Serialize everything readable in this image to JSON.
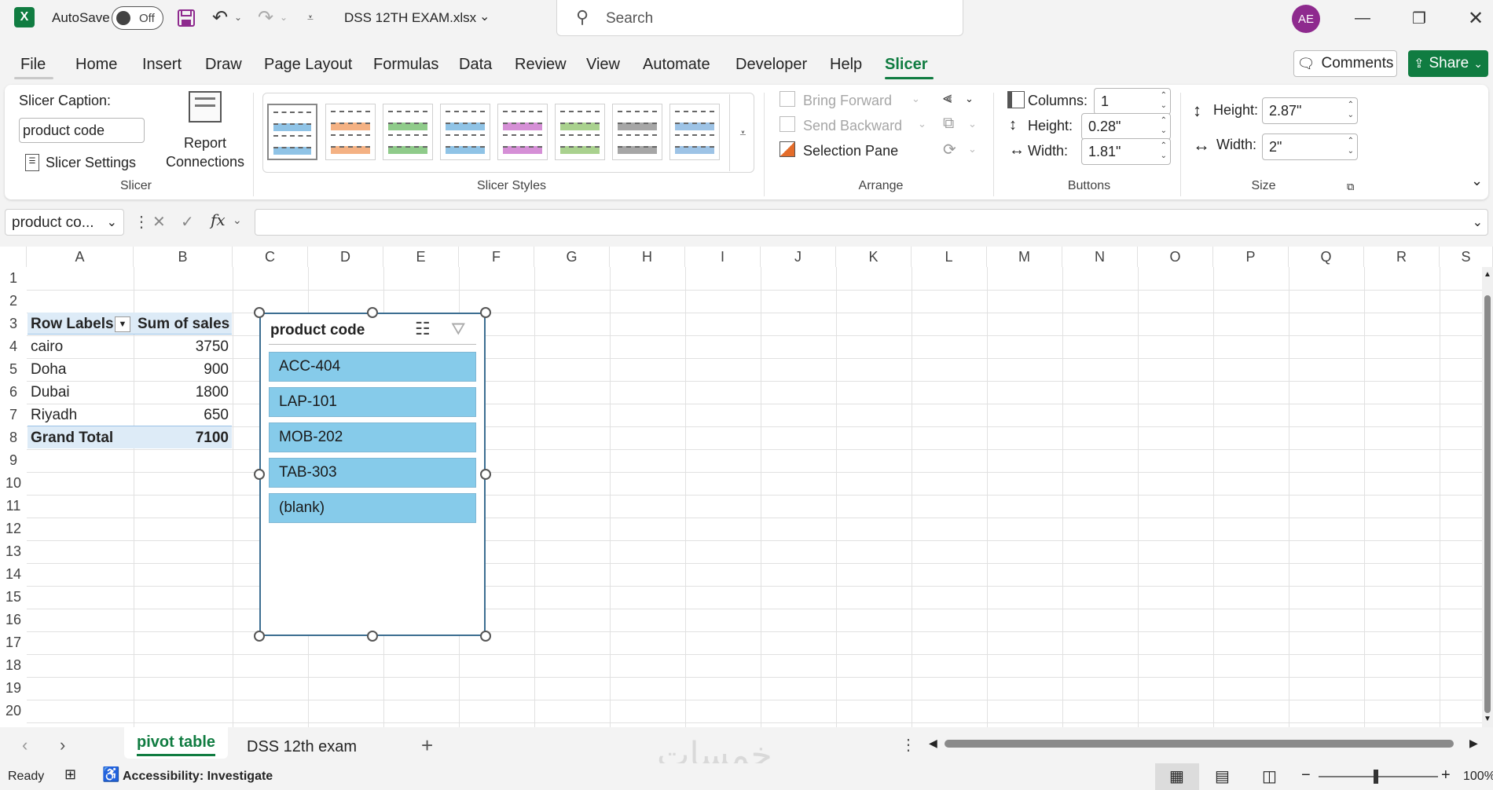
{
  "titlebar": {
    "autosave_label": "AutoSave",
    "autosave_state": "Off",
    "filename": "DSS 12TH EXAM.xlsx",
    "search_placeholder": "Search",
    "avatar_initials": "AE"
  },
  "tabs": [
    {
      "label": "File"
    },
    {
      "label": "Home"
    },
    {
      "label": "Insert"
    },
    {
      "label": "Draw"
    },
    {
      "label": "Page Layout"
    },
    {
      "label": "Formulas"
    },
    {
      "label": "Data"
    },
    {
      "label": "Review"
    },
    {
      "label": "View"
    },
    {
      "label": "Automate"
    },
    {
      "label": "Developer"
    },
    {
      "label": "Help"
    },
    {
      "label": "Slicer"
    }
  ],
  "header_buttons": {
    "comments": "Comments",
    "share": "Share"
  },
  "ribbon": {
    "slicer_group": {
      "caption_label": "Slicer Caption:",
      "caption_value": "product code",
      "settings_label": "Slicer Settings",
      "report_connections_line1": "Report",
      "report_connections_line2": "Connections",
      "group_label": "Slicer"
    },
    "styles_group": {
      "group_label": "Slicer Styles"
    },
    "arrange_group": {
      "bring_forward": "Bring Forward",
      "send_backward": "Send Backward",
      "selection_pane": "Selection Pane",
      "group_label": "Arrange"
    },
    "buttons_group": {
      "columns_label": "Columns:",
      "columns_value": "1",
      "height_label": "Height:",
      "height_value": "0.28\"",
      "width_label": "Width:",
      "width_value": "1.81\"",
      "group_label": "Buttons"
    },
    "size_group": {
      "height_label": "Height:",
      "height_value": "2.87\"",
      "width_label": "Width:",
      "width_value": "2\"",
      "group_label": "Size"
    }
  },
  "formula_bar": {
    "name_box": "product co...",
    "fx": "fx",
    "formula": ""
  },
  "columns": [
    "A",
    "B",
    "C",
    "D",
    "E",
    "F",
    "G",
    "H",
    "I",
    "J",
    "K",
    "L",
    "M",
    "N",
    "O",
    "P",
    "Q",
    "R",
    "S"
  ],
  "rows": [
    "1",
    "2",
    "3",
    "4",
    "5",
    "6",
    "7",
    "8",
    "9",
    "10",
    "11",
    "12",
    "13",
    "14",
    "15",
    "16",
    "17",
    "18",
    "19",
    "20"
  ],
  "pivot": {
    "header_row_labels": "Row Labels",
    "header_sum": "Sum of sales",
    "rows": [
      {
        "label": "cairo",
        "value": "3750"
      },
      {
        "label": "Doha",
        "value": "900"
      },
      {
        "label": "Dubai",
        "value": "1800"
      },
      {
        "label": "Riyadh",
        "value": "650"
      }
    ],
    "total_label": "Grand Total",
    "total_value": "7100"
  },
  "slicer": {
    "title": "product code",
    "items": [
      "ACC-404",
      "LAP-101",
      "MOB-202",
      "TAB-303",
      "(blank)"
    ]
  },
  "sheets": [
    {
      "label": "pivot table",
      "active": true
    },
    {
      "label": "DSS 12th exam",
      "active": false
    }
  ],
  "watermark": "خمسات",
  "status": {
    "ready": "Ready",
    "accessibility": "Accessibility: Investigate",
    "zoom": "100%"
  },
  "colors": {
    "excel_green": "#107c41",
    "slicer_item": "#86cbea",
    "pivot_header": "#ddebf7",
    "avatar": "#8e2a8e"
  }
}
